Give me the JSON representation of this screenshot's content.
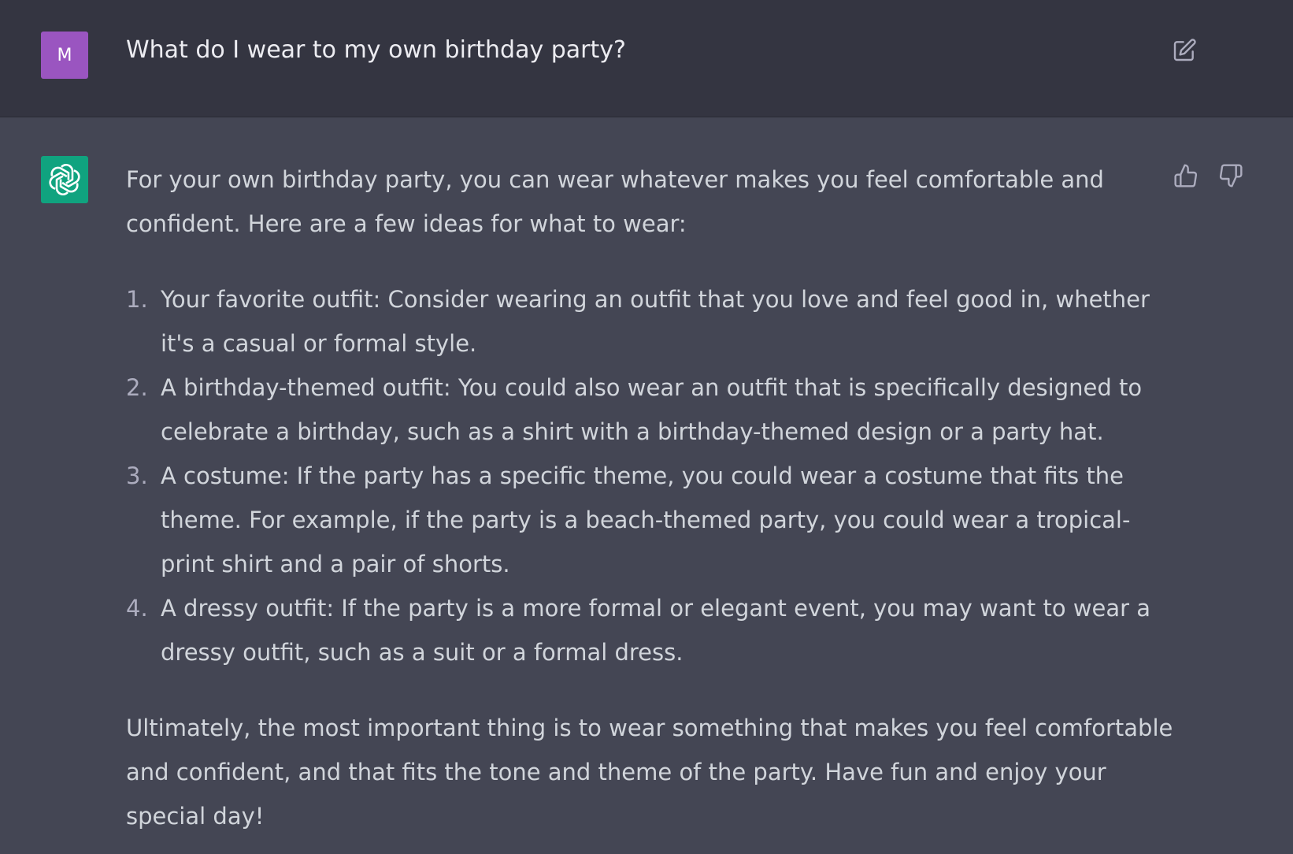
{
  "user_message": {
    "avatar_letter": "M",
    "text": "What do I wear to my own birthday party?"
  },
  "assistant_message": {
    "intro": "For your own birthday party, you can wear whatever makes you feel comfortable and confident. Here are a few ideas for what to wear:",
    "items": [
      {
        "number": "1.",
        "text": "Your favorite outfit: Consider wearing an outfit that you love and feel good in, whether it's a casual or formal style."
      },
      {
        "number": "2.",
        "text": "A birthday-themed outfit: You could also wear an outfit that is specifically designed to celebrate a birthday, such as a shirt with a birthday-themed design or a party hat."
      },
      {
        "number": "3.",
        "text": "A costume: If the party has a specific theme, you could wear a costume that fits the theme. For example, if the party is a beach-themed party, you could wear a tropical-print shirt and a pair of shorts."
      },
      {
        "number": "4.",
        "text": "A dressy outfit: If the party is a more formal or elegant event, you may want to wear a dressy outfit, such as a suit or a formal dress."
      }
    ],
    "conclusion": "Ultimately, the most important thing is to wear something that makes you feel comfortable and confident, and that fits the tone and theme of the party. Have fun and enjoy your special day!"
  },
  "icons": {
    "edit": "edit-icon",
    "thumbs_up": "thumbs-up-icon",
    "thumbs_down": "thumbs-down-icon",
    "bot_logo": "openai-logo-icon"
  },
  "colors": {
    "user_bg": "#343541",
    "assistant_bg": "#444654",
    "user_avatar": "#9a55c0",
    "bot_avatar": "#10a37f",
    "text": "#d1d5db"
  }
}
